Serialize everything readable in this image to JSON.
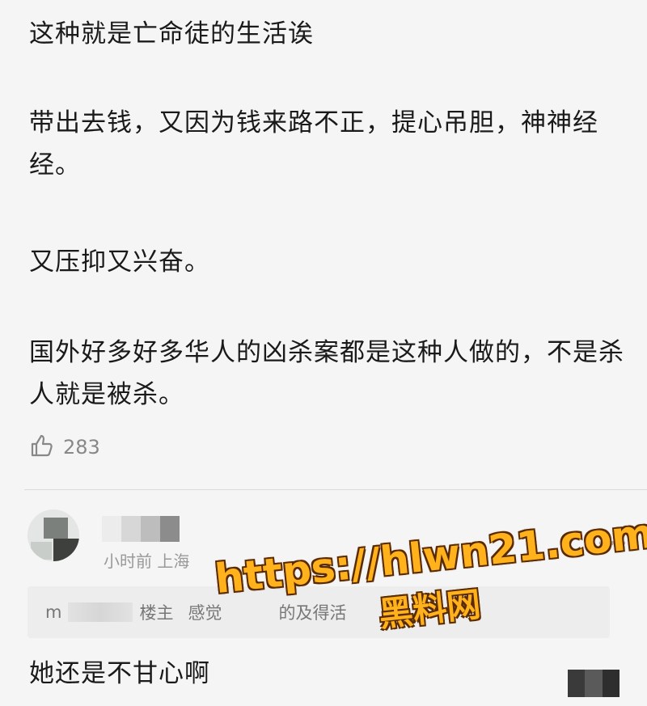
{
  "comment": {
    "paragraphs": [
      "这种就是亡命徒的生活诶",
      "带出去钱，又因为钱来路不正，提心吊胆，神神经经。",
      "又压抑又兴奋。",
      "国外好多好多华人的凶杀案都是这种人做的，不是杀人就是被杀。"
    ],
    "like_count": "283"
  },
  "reply": {
    "meta": "小时前 上海",
    "quote": {
      "user_fragment": "m",
      "owner_badge": "楼主",
      "text": "感觉",
      "text_tail": "的及得活"
    },
    "text": "她还是不甘心啊"
  },
  "watermark": {
    "url": "https://hlwn21.com",
    "name": "黑料网"
  },
  "colors": {
    "background": "#f5f5f5",
    "text": "#1a1a1a",
    "muted": "#999999",
    "watermark": "#ffb21c"
  }
}
